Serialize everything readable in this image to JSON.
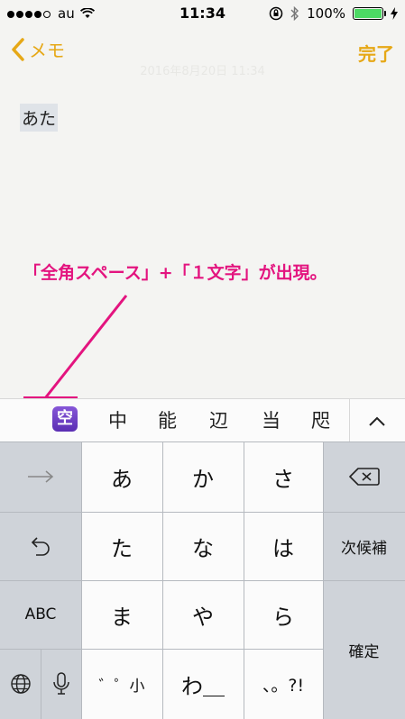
{
  "status_bar": {
    "carrier": "au",
    "time": "11:34",
    "battery": "100%"
  },
  "nav": {
    "back_label": "メモ",
    "done_label": "完了"
  },
  "note": {
    "faint_date": "2016年8月20日 11:34",
    "text": "あた"
  },
  "annotation": {
    "text": "「全角スペース」+「１文字」が出現。",
    "color": "#e3147f"
  },
  "candidates": {
    "space_badge": "空",
    "items": [
      "中",
      "能",
      "辺",
      "当",
      "咫"
    ]
  },
  "keyboard": {
    "row1": [
      "あ",
      "か",
      "さ"
    ],
    "row2": [
      "た",
      "な",
      "は"
    ],
    "row3": [
      "ま",
      "や",
      "ら"
    ],
    "row4": [
      "゛゜小",
      "わ＿",
      "、。?!"
    ],
    "next_candidate": "次候補",
    "abc": "ABC",
    "confirm": "確定"
  },
  "colors": {
    "accent": "#e6a817",
    "annotation": "#e3147f",
    "battery": "#4cd964"
  }
}
